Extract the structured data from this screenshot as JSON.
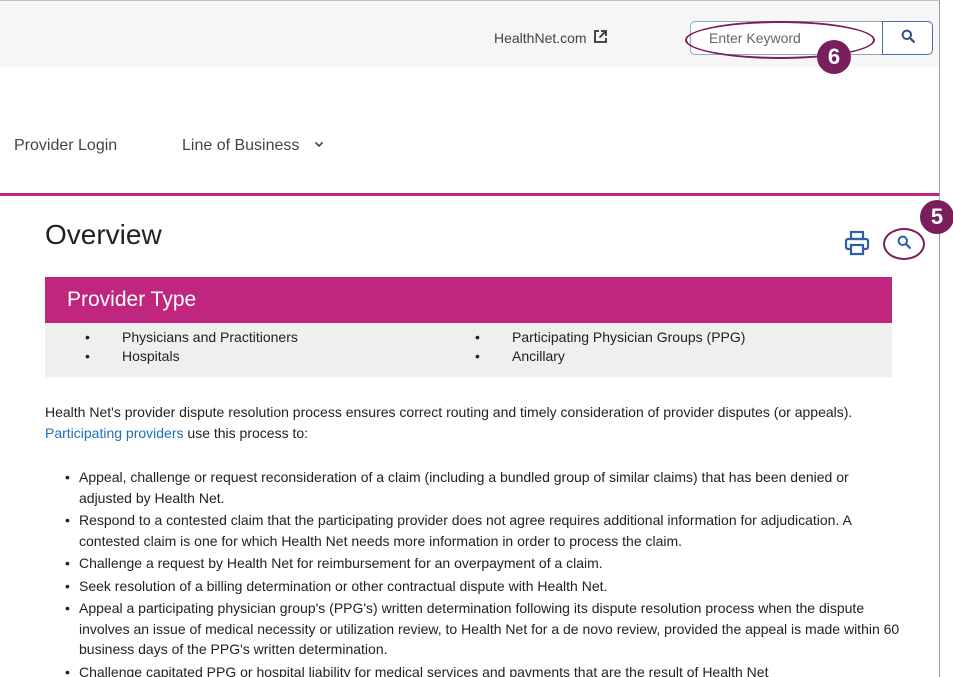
{
  "header": {
    "external_link": "HealthNet.com",
    "search_placeholder": "Enter Keyword"
  },
  "callouts": {
    "badge_6": "6",
    "badge_5": "5"
  },
  "nav": {
    "provider_login": "Provider Login",
    "line_of_business": "Line of Business"
  },
  "main": {
    "title": "Overview",
    "provider_type": {
      "heading": "Provider Type",
      "left": [
        "Physicians and Practitioners",
        "Hospitals"
      ],
      "right": [
        "Participating Physician Groups (PPG)",
        "Ancillary"
      ]
    },
    "intro_before_link": "Health Net's provider dispute resolution process ensures correct routing and timely consideration of provider disputes (or appeals). ",
    "intro_link": "Participating providers",
    "intro_after_link": " use this process to:",
    "bullets": [
      "Appeal, challenge or request reconsideration of a claim (including a bundled group of similar claims) that has been denied or adjusted by Health Net.",
      "Respond to a contested claim that the participating provider does not agree requires additional information for adjudication. A contested claim is one for which Health Net needs more information in order to process the claim.",
      "Challenge a request by Health Net for reimbursement for an overpayment of a claim.",
      "Seek resolution of a billing determination or other contractual dispute with Health Net.",
      "Appeal a participating physician group's (PPG's) written determination following its dispute resolution process when the dispute involves an issue of medical necessity or utilization review, to Health Net for a de novo review, provided the appeal is made within 60 business days of the PPG's written determination.",
      "Challenge capitated PPG or hospital liability for medical services and payments that are the result of Health Net"
    ]
  },
  "colors": {
    "accent": "#c0267e",
    "callout": "#7a1f5c",
    "link": "#1f6fb5",
    "button_border": "#4a6fa3"
  },
  "icons": [
    "external-link-icon",
    "search-icon",
    "chevron-down-icon",
    "print-icon"
  ]
}
